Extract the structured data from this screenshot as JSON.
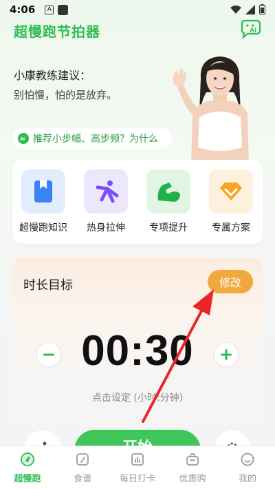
{
  "status_bar": {
    "time": "4:06",
    "icon_a": "A"
  },
  "header": {
    "title": "超慢跑节拍器",
    "ai_label": "AI"
  },
  "coach": {
    "label": "小康教练建议：",
    "text": "别怕慢，怕的是放弃。"
  },
  "tip": {
    "text": "推荐小步幅、高步频？为什么"
  },
  "features": [
    {
      "label": "超慢跑知识",
      "icon": "book-icon",
      "color": "#3b82f6"
    },
    {
      "label": "热身拉伸",
      "icon": "stretch-icon",
      "color": "#8b5cf6"
    },
    {
      "label": "专项提升",
      "icon": "muscle-icon",
      "color": "#22c55e"
    },
    {
      "label": "专属方案",
      "icon": "diamond-icon",
      "color": "#f59e0b"
    }
  ],
  "timer": {
    "title": "时长目标",
    "modify_label": "修改",
    "display": "00:30",
    "hint": "点击设定 (小时:分钟)"
  },
  "start": {
    "label": "开始"
  },
  "nav": [
    {
      "label": "超慢跑",
      "icon": "run-icon",
      "active": true
    },
    {
      "label": "食谱",
      "icon": "recipe-icon",
      "active": false
    },
    {
      "label": "每日打卡",
      "icon": "calendar-chart-icon",
      "active": false
    },
    {
      "label": "优惠购",
      "icon": "bag-icon",
      "active": false
    },
    {
      "label": "我的",
      "icon": "profile-icon",
      "active": false
    }
  ],
  "colors": {
    "accent": "#2dbd4f",
    "modify": "#f0a93e",
    "arrow": "#e8262a"
  }
}
